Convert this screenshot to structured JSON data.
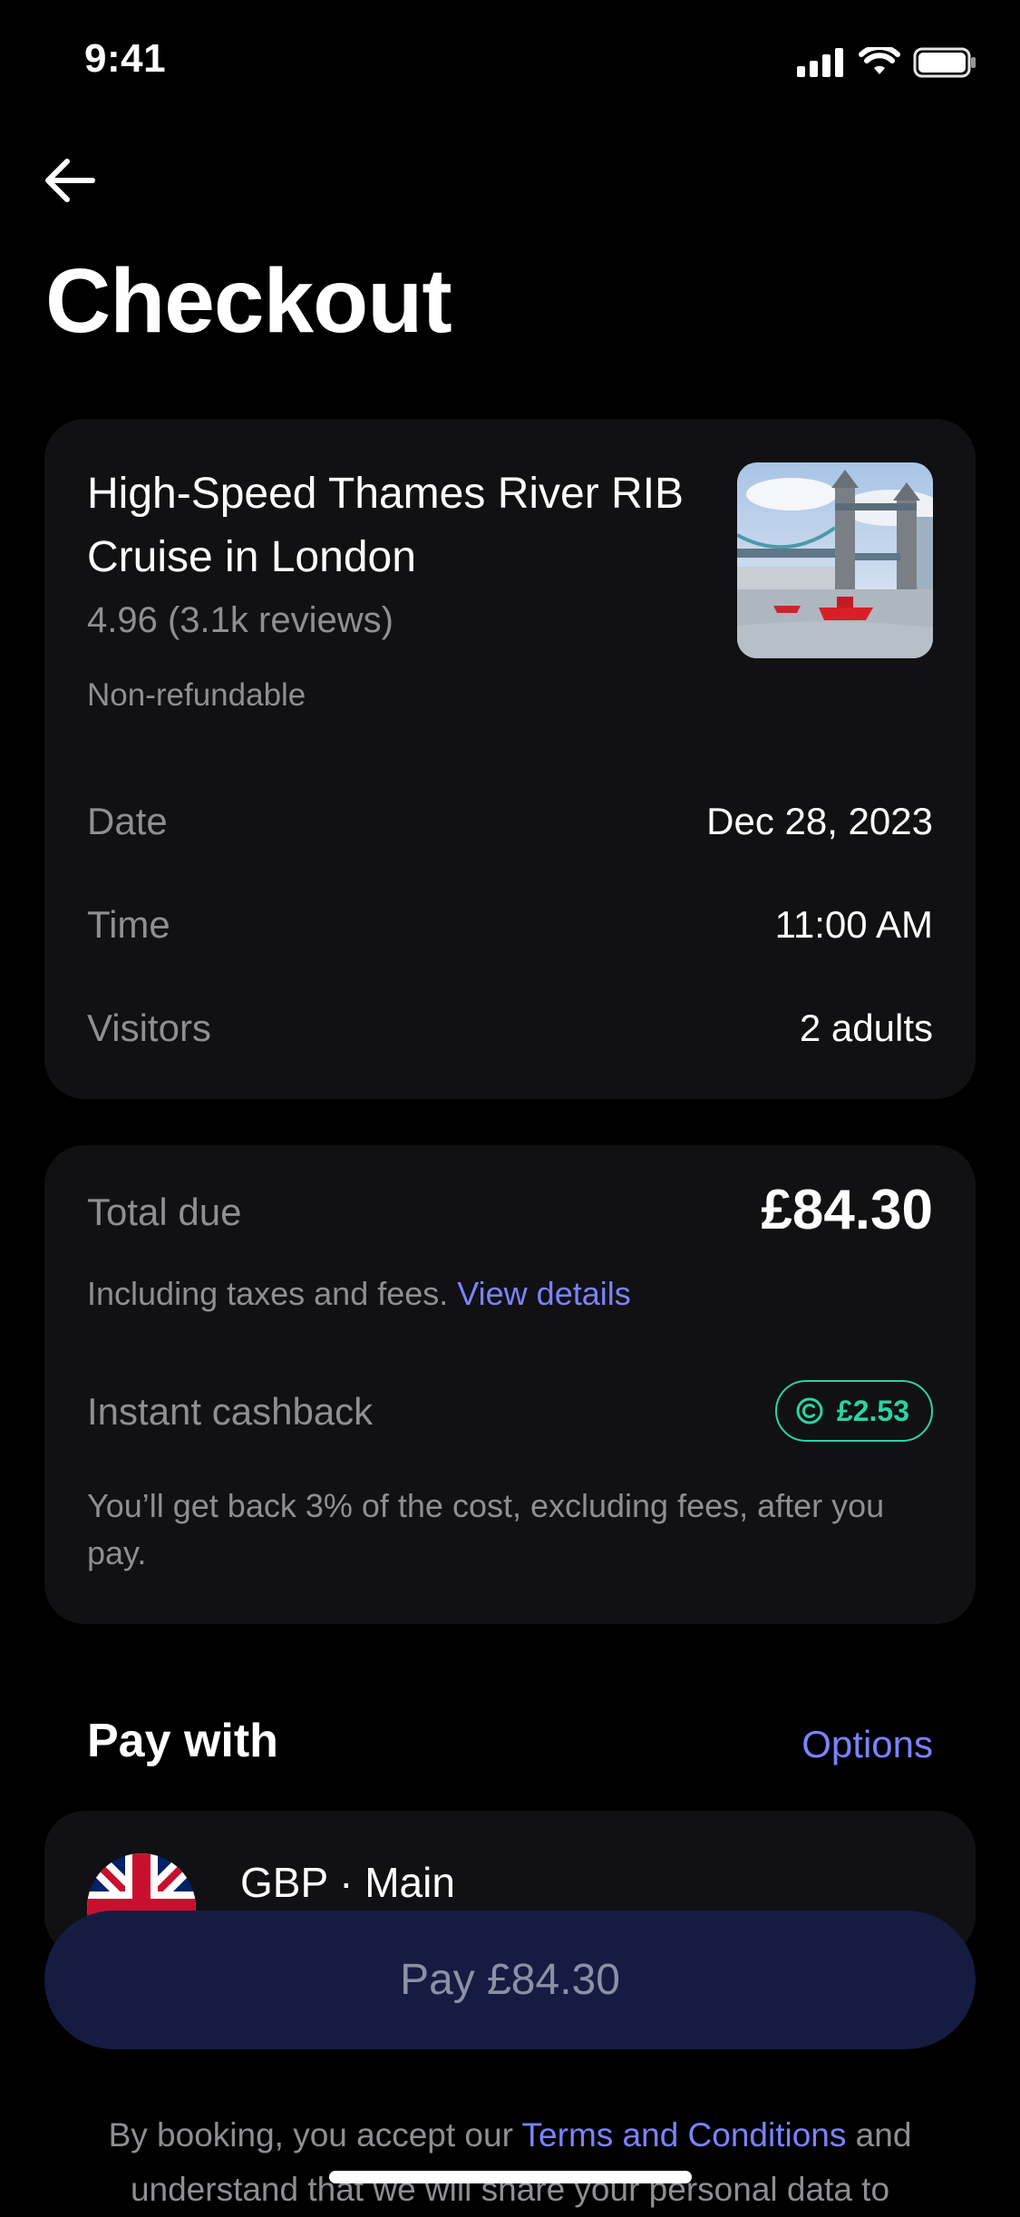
{
  "status_bar": {
    "time": "9:41"
  },
  "header": {
    "title": "Checkout"
  },
  "activity": {
    "title": "High-Speed Thames River RIB Cruise in London",
    "rating": "4.96 (3.1k reviews)",
    "refund_policy": "Non-refundable",
    "details": [
      {
        "label": "Date",
        "value": "Dec 28, 2023"
      },
      {
        "label": "Time",
        "value": "11:00 AM"
      },
      {
        "label": "Visitors",
        "value": "2 adults"
      }
    ]
  },
  "summary": {
    "total_label": "Total due",
    "total_value": "£84.30",
    "includes_text": "Including taxes and fees.",
    "view_details": "View details",
    "cashback_label": "Instant cashback",
    "cashback_value": "£2.53",
    "cashback_desc": "You’ll get back 3% of the cost, excluding fees, after you pay."
  },
  "payment": {
    "section_title": "Pay with",
    "options_label": "Options",
    "account": "GBP · Main",
    "pay_button": "Pay £84.30"
  },
  "legal": {
    "prefix": "By booking, you accept our",
    "terms_link": "Terms and Conditions",
    "suffix": "and understand that we will share your personal data to"
  },
  "colors": {
    "accent": "#7b83ff",
    "cashback": "#2bd4a4",
    "card_bg": "#111113",
    "pay_button_bg": "#161c41"
  }
}
